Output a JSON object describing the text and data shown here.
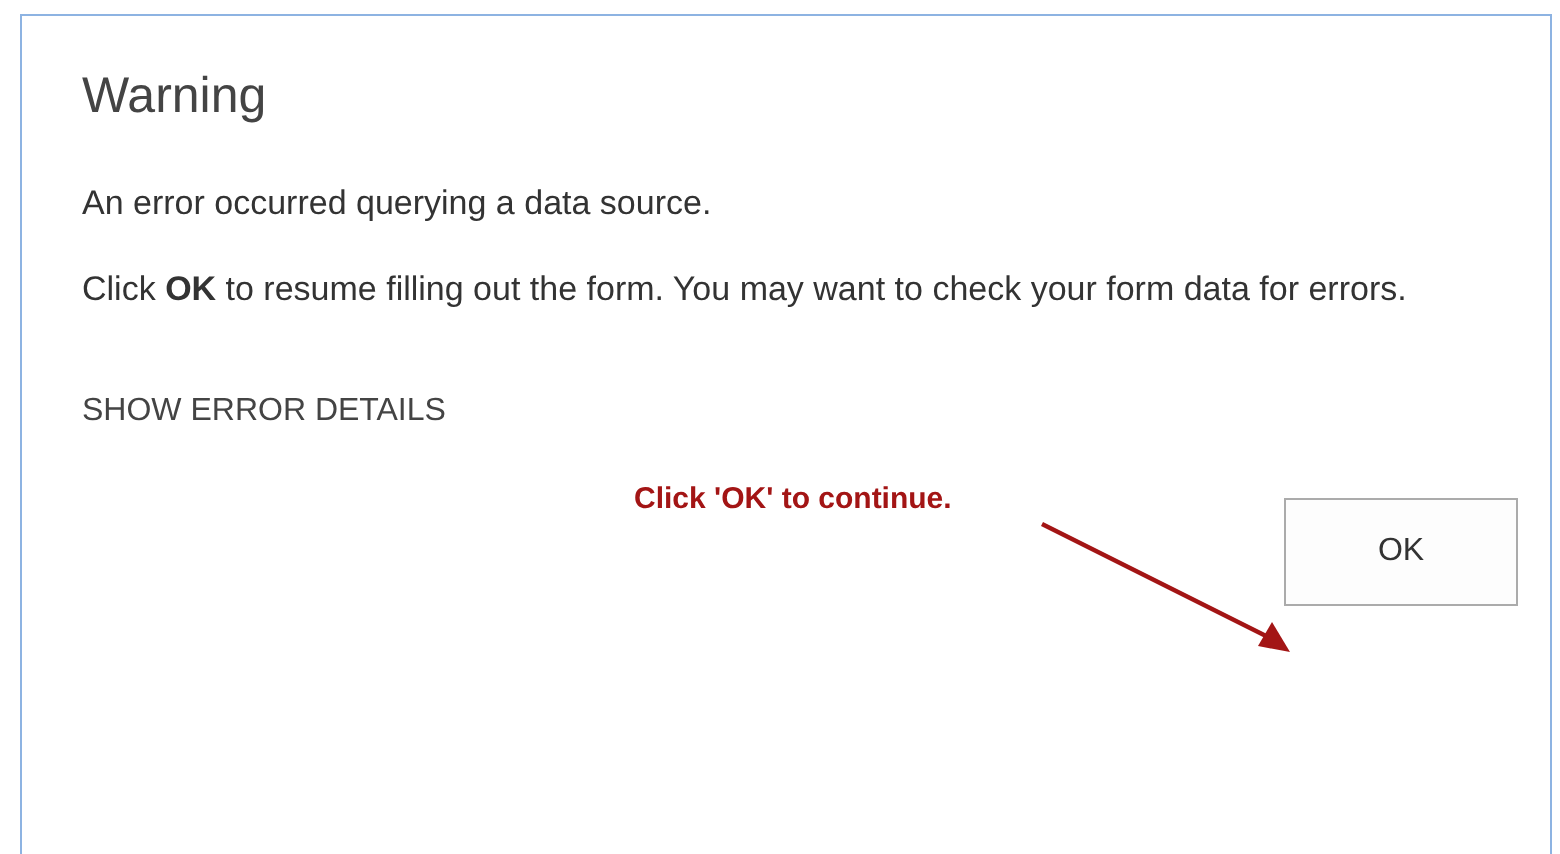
{
  "dialog": {
    "title": "Warning",
    "paragraphs": [
      "An error occurred querying a data source.",
      "Click **OK** to resume filling out the form. You may want to check your form data for errors."
    ],
    "details_link": "SHOW ERROR DETAILS",
    "buttons": [
      "OK"
    ]
  },
  "annotation": {
    "text": "Click 'OK' to continue."
  }
}
